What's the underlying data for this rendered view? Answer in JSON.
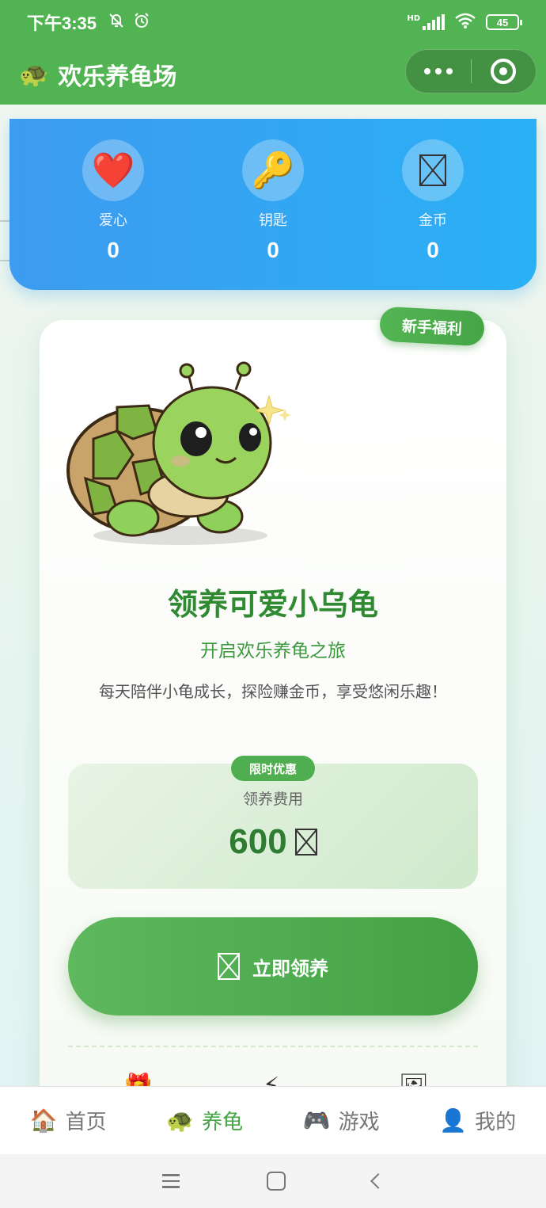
{
  "status_bar": {
    "time": "下午3:35",
    "network": "HD",
    "battery": "45",
    "icons": [
      "mute-bell-icon",
      "alarm-icon",
      "signal-icon",
      "wifi-icon",
      "battery-icon"
    ]
  },
  "header": {
    "logo_icon": "turtle-icon",
    "logo": "🐢",
    "title": "欢乐养龟场",
    "capsule_more_icon": "more-dots-icon",
    "capsule_close_icon": "target-close-icon"
  },
  "stats": [
    {
      "icon": "heart-icon",
      "glyph": "❤️",
      "label": "爱心",
      "value": "0"
    },
    {
      "icon": "key-icon",
      "glyph": "🔑",
      "label": "钥匙",
      "value": "0"
    },
    {
      "icon": "coin-icon",
      "glyph": "",
      "label": "金币",
      "value": "0"
    }
  ],
  "card": {
    "badge": "新手福利",
    "title": "领养可爱小乌龟",
    "subtitle": "开启欢乐养龟之旅",
    "description": "每天陪伴小龟成长，探险赚金币，享受悠闲乐趣！",
    "price": {
      "badge": "限时优惠",
      "label": "领养费用",
      "value": "600"
    },
    "adopt_button": "立即领养",
    "peek_icons": [
      "gift-icon",
      "lightning-icon",
      "picture-icon"
    ]
  },
  "bottom_nav": [
    {
      "icon": "house-icon",
      "glyph": "🏠",
      "label": "首页",
      "active": false
    },
    {
      "icon": "turtle-icon",
      "glyph": "🐢",
      "label": "养龟",
      "active": true
    },
    {
      "icon": "gamepad-icon",
      "glyph": "🎮",
      "label": "游戏",
      "active": false
    },
    {
      "icon": "user-icon",
      "glyph": "👤",
      "label": "我的",
      "active": false
    }
  ],
  "colors": {
    "primary_green": "#52b352",
    "stats_blue": "#2ab0f5",
    "title_green": "#2f8a32"
  }
}
